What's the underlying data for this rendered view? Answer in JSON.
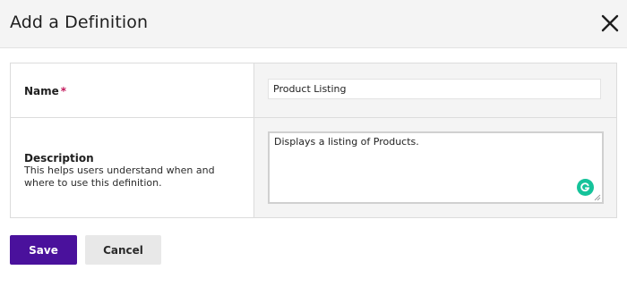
{
  "dialog": {
    "title": "Add a Definition",
    "close_icon": "close-icon"
  },
  "form": {
    "name": {
      "label": "Name",
      "required_marker": "*",
      "value": "Product Listing"
    },
    "description": {
      "label": "Description",
      "help_text": "This helps users understand when and where to use this definition.",
      "value": "Displays a listing of Products.",
      "assistant_icon": "grammarly-icon"
    }
  },
  "actions": {
    "save_label": "Save",
    "cancel_label": "Cancel"
  },
  "colors": {
    "primary": "#4a119c",
    "required": "#c2185b",
    "grammarly": "#15c39a"
  }
}
